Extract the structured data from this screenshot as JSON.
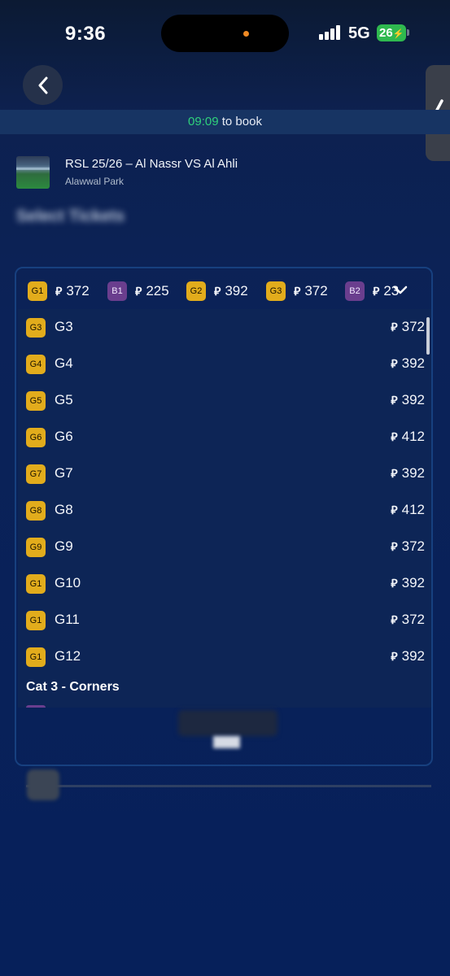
{
  "status_bar": {
    "time": "9:36",
    "network": "5G",
    "battery": "26"
  },
  "timer": {
    "time": "09:09",
    "suffix": " to book"
  },
  "event": {
    "title": "RSL 25/26 – Al Nassr VS Al Ahli",
    "venue": "Alawwal Park"
  },
  "section_title": "Select Tickets",
  "currency_symbol": "⃁",
  "chips": [
    {
      "code": "G1",
      "color": "gold",
      "price": "372"
    },
    {
      "code": "B1",
      "color": "purple",
      "price": "225"
    },
    {
      "code": "G2",
      "color": "gold",
      "price": "392"
    },
    {
      "code": "G3",
      "color": "gold",
      "price": "372"
    },
    {
      "code": "B2",
      "color": "purple",
      "price": "23"
    }
  ],
  "rows": [
    {
      "badge": "G3",
      "name": "G3",
      "price": "372"
    },
    {
      "badge": "G4",
      "name": "G4",
      "price": "392"
    },
    {
      "badge": "G5",
      "name": "G5",
      "price": "392"
    },
    {
      "badge": "G6",
      "name": "G6",
      "price": "412"
    },
    {
      "badge": "G7",
      "name": "G7",
      "price": "392"
    },
    {
      "badge": "G8",
      "name": "G8",
      "price": "412"
    },
    {
      "badge": "G9",
      "name": "G9",
      "price": "372"
    },
    {
      "badge": "G1",
      "name": "G10",
      "price": "392"
    },
    {
      "badge": "G1",
      "name": "G11",
      "price": "372"
    },
    {
      "badge": "G1",
      "name": "G12",
      "price": "392"
    }
  ],
  "category_heading": "Cat 3 - Corners",
  "colors": {
    "gold": "#e2ac1c",
    "purple": "#6a3e8e",
    "timer_green": "#2fd17b"
  },
  "icons": {
    "back": "chevron-left-icon",
    "side_tab": "chevron-left-icon",
    "dropdown": "chevron-down-icon",
    "search": "search-icon"
  }
}
